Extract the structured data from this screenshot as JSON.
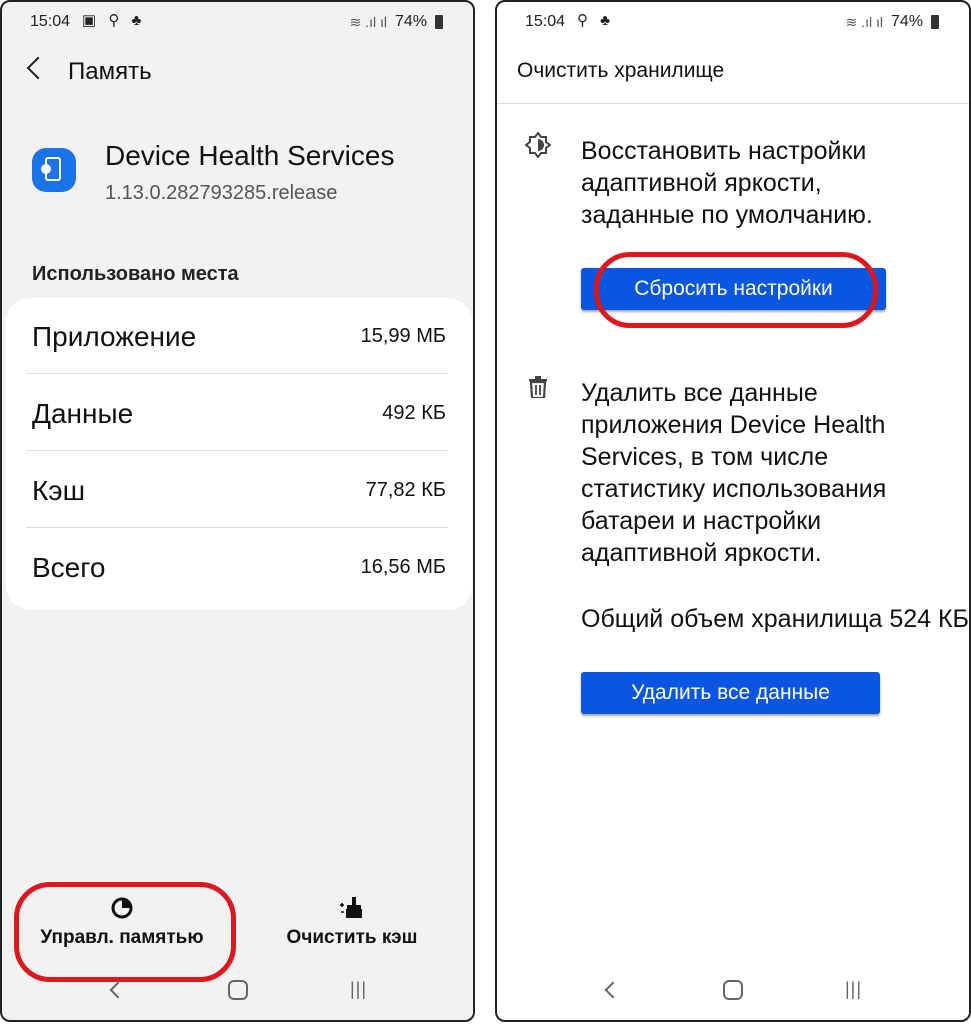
{
  "left": {
    "status": {
      "time": "15:04",
      "battery": "74%"
    },
    "header_title": "Память",
    "app_name": "Device Health Services",
    "app_version": "1.13.0.282793285.release",
    "section_label": "Использовано места",
    "rows": [
      {
        "label": "Приложение",
        "value": "15,99 МБ"
      },
      {
        "label": "Данные",
        "value": "492 КБ"
      },
      {
        "label": "Кэш",
        "value": "77,82 КБ"
      },
      {
        "label": "Всего",
        "value": "16,56 МБ"
      }
    ],
    "manage_memory_label": "Управл. памятью",
    "clear_cache_label": "Очистить кэш"
  },
  "right": {
    "status": {
      "time": "15:04",
      "battery": "74%"
    },
    "title": "Очистить хранилище",
    "reset_description": "Восстановить настройки адаптивной яркости, заданные по умолчанию.",
    "reset_button": "Сбросить настройки",
    "delete_description": "Удалить все данные приложения Device Health Services, в том числе статистику использования батареи и настройки адаптивной яркости.",
    "total_storage_label": "Общий объем хранилища",
    "total_storage_value": "524 КБ",
    "delete_button": "Удалить все данные"
  },
  "colors": {
    "accent_blue": "#0b56e0",
    "highlight_red": "#e0161f",
    "app_icon_blue": "#1a73e8"
  }
}
